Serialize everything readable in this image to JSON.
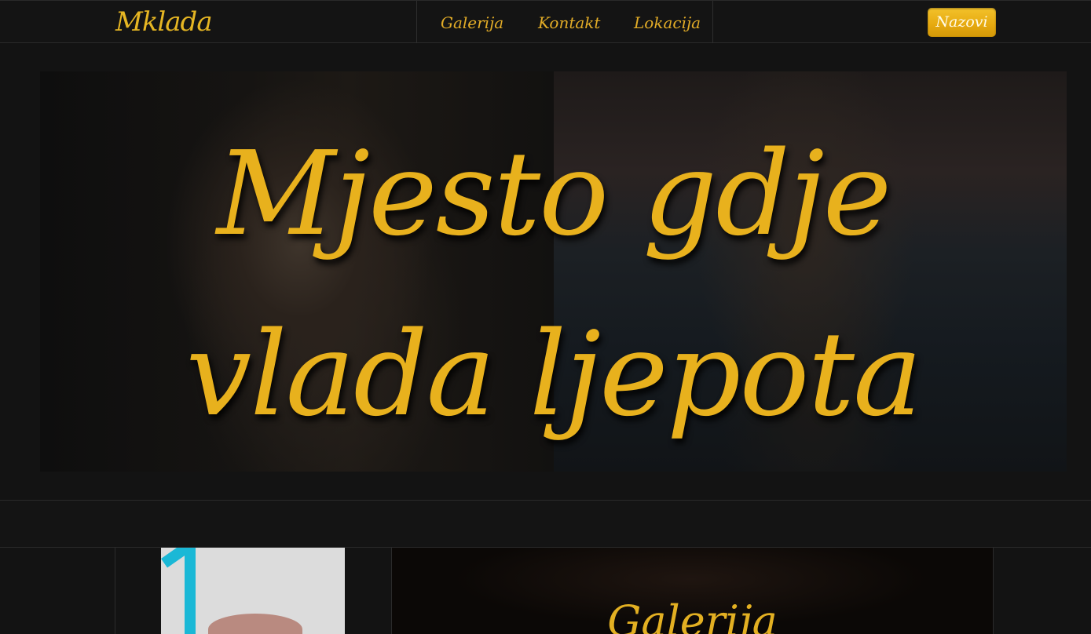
{
  "header": {
    "logo": "Mklada",
    "nav": [
      "Galerija",
      "Kontakt",
      "Lokacija"
    ],
    "call_button": "Nazovi"
  },
  "hero": {
    "line1": "Mjesto gdje",
    "line2": "vlada ljepota"
  },
  "gallery": {
    "title": "Galerija"
  },
  "colors": {
    "accent_gold": "#e8b11d",
    "background": "#131313"
  }
}
